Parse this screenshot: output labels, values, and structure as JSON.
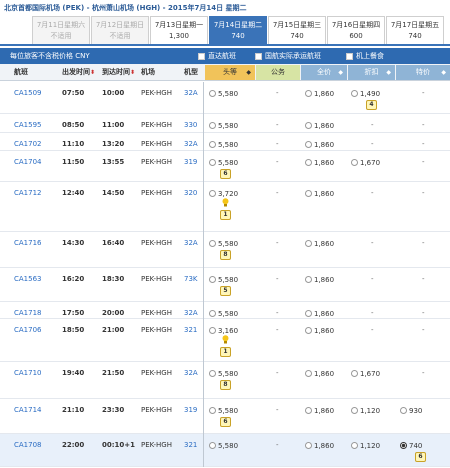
{
  "route_title": "北京首都国际机场 (PEK) - 杭州萧山机场 (HGH) - 2015年7月14日 星期二",
  "date_tabs": [
    {
      "title": "7月11日星期六",
      "price": "不适用",
      "state": "disabled"
    },
    {
      "title": "7月12日星期日",
      "price": "不适用",
      "state": "disabled"
    },
    {
      "title": "7月13日星期一",
      "price": "1,300",
      "state": "normal"
    },
    {
      "title": "7月14日星期二",
      "price": "740",
      "state": "active"
    },
    {
      "title": "7月15日星期三",
      "price": "740",
      "state": "normal"
    },
    {
      "title": "7月16日星期四",
      "price": "600",
      "state": "normal"
    },
    {
      "title": "7月17日星期五",
      "price": "740",
      "state": "normal"
    }
  ],
  "filters": {
    "fare_note": "每位旅客不含税价格 CNY",
    "direct": "直达航班",
    "codeshare": "国航实际承运航班",
    "meal": "机上餐食"
  },
  "headers": {
    "flight": "航班",
    "dep": "出发时间",
    "arr": "到达时间",
    "route": "机场",
    "aircraft": "机型",
    "first": "头等",
    "business": "公务",
    "full": "全价",
    "discount": "折扣",
    "special": "特价"
  },
  "flights": [
    {
      "fno": "CA1509",
      "dep": "07:50",
      "arr": "10:00",
      "route": "PEK-HGH",
      "ac": "32A",
      "first": "5,580",
      "full": "1,860",
      "disc": "1,490",
      "disc_seat": "4",
      "spec": "-"
    },
    {
      "fno": "CA1595",
      "dep": "08:50",
      "arr": "11:00",
      "route": "PEK-HGH",
      "ac": "330",
      "first": "5,580",
      "full": "1,860",
      "disc": "-",
      "spec": "-"
    },
    {
      "fno": "CA1702",
      "dep": "11:10",
      "arr": "13:20",
      "route": "PEK-HGH",
      "ac": "32A",
      "first": "5,580",
      "full": "1,860",
      "disc": "-",
      "spec": "-"
    },
    {
      "fno": "CA1704",
      "dep": "11:50",
      "arr": "13:55",
      "route": "PEK-HGH",
      "ac": "319",
      "first": "5,580",
      "first_seat": "6",
      "full": "1,860",
      "disc": "1,670",
      "spec": "-"
    },
    {
      "fno": "CA1712",
      "dep": "12:40",
      "arr": "14:50",
      "route": "PEK-HGH",
      "ac": "320",
      "first": "3,720",
      "first_bulb": true,
      "first_seat": "1",
      "full": "1,860",
      "disc": "-",
      "spec": "-"
    },
    {
      "fno": "CA1716",
      "dep": "14:30",
      "arr": "16:40",
      "route": "PEK-HGH",
      "ac": "32A",
      "first": "5,580",
      "first_seat": "8",
      "full": "1,860",
      "disc": "-",
      "spec": "-"
    },
    {
      "fno": "CA1563",
      "dep": "16:20",
      "arr": "18:30",
      "route": "PEK-HGH",
      "ac": "73K",
      "first": "5,580",
      "first_seat": "5",
      "full": "1,860",
      "disc": "-",
      "spec": "-"
    },
    {
      "fno": "CA1718",
      "dep": "17:50",
      "arr": "20:00",
      "route": "PEK-HGH",
      "ac": "32A",
      "first": "5,580",
      "full": "1,860",
      "disc": "-",
      "spec": "-"
    },
    {
      "fno": "CA1706",
      "dep": "18:50",
      "arr": "21:00",
      "route": "PEK-HGH",
      "ac": "321",
      "first": "3,160",
      "first_bulb": true,
      "first_seat": "1",
      "full": "1,860",
      "disc": "-",
      "spec": "-"
    },
    {
      "fno": "CA1710",
      "dep": "19:40",
      "arr": "21:50",
      "route": "PEK-HGH",
      "ac": "32A",
      "first": "5,580",
      "first_seat": "8",
      "full": "1,860",
      "disc": "1,670",
      "spec": "-"
    },
    {
      "fno": "CA1714",
      "dep": "21:10",
      "arr": "23:30",
      "route": "PEK-HGH",
      "ac": "319",
      "first": "5,580",
      "first_seat": "6",
      "full": "1,860",
      "disc": "1,120",
      "spec": "930"
    },
    {
      "fno": "CA1708",
      "dep": "22:00",
      "arr": "00:10+1",
      "route": "PEK-HGH",
      "ac": "321",
      "first": "5,580",
      "full": "1,860",
      "disc": "1,120",
      "spec": "740",
      "spec_seat": "6",
      "spec_selected": true
    }
  ],
  "colors": {
    "accent": "#2e6ab1",
    "first_cabin": "#f1c35a",
    "business_cabin": "#d7e4a4",
    "economy_cabin": "#8fb4d6",
    "flight_link": "#2a6cc3"
  }
}
